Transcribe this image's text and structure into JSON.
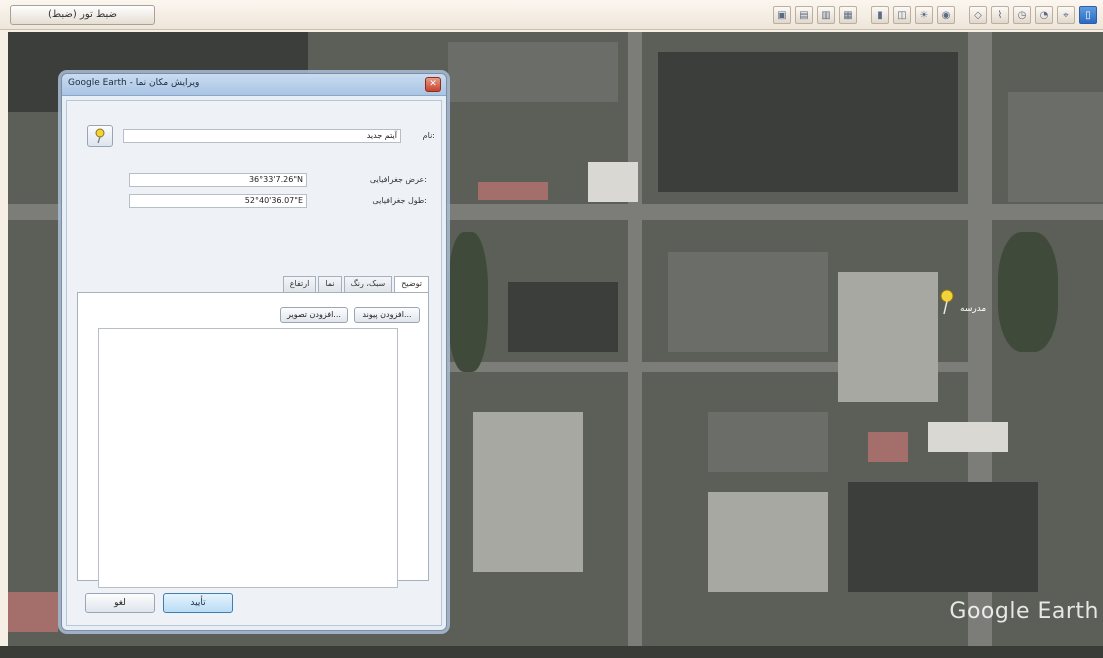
{
  "toolbar": {
    "tour_button_label": "ضبط تور (ضبط)",
    "icons": [
      "sidebar-toggle-icon",
      "placemark-icon",
      "polygon-icon",
      "path-icon",
      "overlay-icon",
      "record-tour-icon",
      "historical-imagery-icon",
      "sunlight-icon",
      "planets-icon",
      "ruler-icon",
      "email-icon",
      "print-icon",
      "save-image-icon",
      "google-maps-icon"
    ]
  },
  "map": {
    "watermark": "Google Earth",
    "pin_label": "مدرسه"
  },
  "dialog": {
    "title": "Google Earth - ویرایش مکان نما",
    "close_label": "✕",
    "name_label": "نام:",
    "name_value": "آیتم جدید",
    "latitude_label": "عرض جغرافیایی:",
    "latitude_value": "36°33'7.26\"N",
    "longitude_label": "طول جغرافیایی:",
    "longitude_value": "52°40'36.07\"E",
    "tabs": [
      "توضیح",
      "سبک، رنگ",
      "نما",
      "ارتفاع"
    ],
    "add_link_label": "افزودن پیوند...",
    "add_image_label": "افزودن تصویر...",
    "ok_label": "تأیید",
    "cancel_label": "لغو"
  }
}
